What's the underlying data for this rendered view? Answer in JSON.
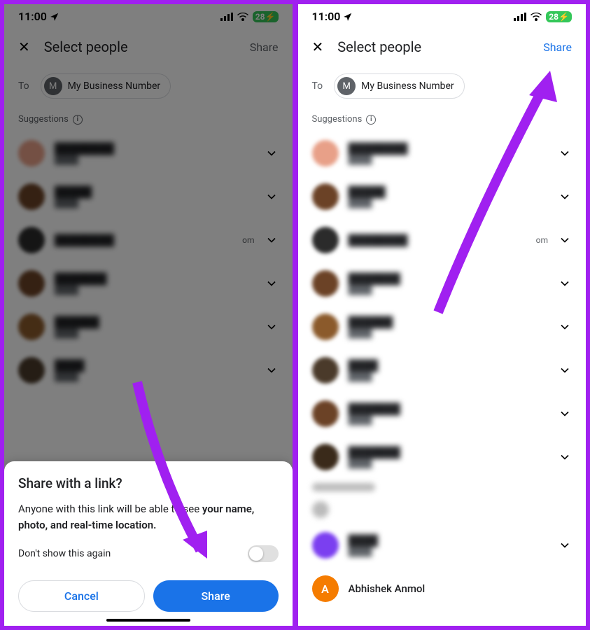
{
  "status": {
    "time": "11:00",
    "battery": "28"
  },
  "header": {
    "title": "Select people",
    "share": "Share"
  },
  "to": {
    "label": "To",
    "chip_initial": "M",
    "chip_label": "My Business Number"
  },
  "suggestions_label": "Suggestions",
  "contact_extra_om": "om",
  "contacts": [
    {
      "avatar_color": "#e8a088"
    },
    {
      "avatar_color": "#6b4226"
    },
    {
      "avatar_color": "#2b2b2b"
    },
    {
      "avatar_color": "#6b4226"
    },
    {
      "avatar_color": "#8b5a2b"
    },
    {
      "avatar_color": "#4a3a2a"
    }
  ],
  "right_extra_contacts": [
    {
      "avatar_color": "#6b4226"
    },
    {
      "avatar_color": "#3a2a1a"
    }
  ],
  "purple_contact_color": "#7b3ff0",
  "last_contact": {
    "initial": "A",
    "name": "Abhishek Anmol"
  },
  "sheet": {
    "title": "Share with a link?",
    "body_pre": "Anyone with this link will be able to see ",
    "body_bold": "your name, photo, and real-time location.",
    "toggle_label": "Don't show this again",
    "cancel": "Cancel",
    "share": "Share"
  }
}
